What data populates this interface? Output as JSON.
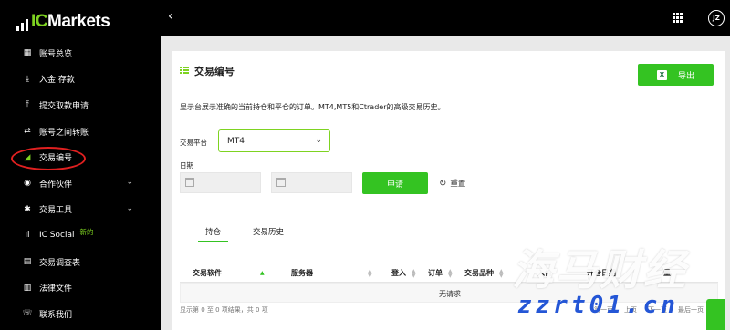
{
  "logo": {
    "prefix": "IC",
    "rest": "Markets"
  },
  "sidebar": {
    "items": [
      {
        "icon": "dashboard-icon",
        "label": "账号总览",
        "glyph": "▦"
      },
      {
        "icon": "deposit-icon",
        "label": "入金 存款",
        "glyph": "⤓"
      },
      {
        "icon": "withdraw-icon",
        "label": "提交取款申请",
        "glyph": "⤒"
      },
      {
        "icon": "transfer-icon",
        "label": "账号之间转账",
        "glyph": "⇄"
      },
      {
        "icon": "trade-history-icon",
        "label": "交易编号",
        "glyph": "◢"
      },
      {
        "icon": "partner-icon",
        "label": "合作伙伴",
        "glyph": "◉"
      },
      {
        "icon": "tools-icon",
        "label": "交易工具",
        "glyph": "✱"
      },
      {
        "icon": "ic-social-icon",
        "label": "IC Social",
        "glyph": "ıl",
        "badge": "新的"
      },
      {
        "icon": "survey-icon",
        "label": "交易调查表",
        "glyph": "▤"
      },
      {
        "icon": "legal-icon",
        "label": "法律文件",
        "glyph": "▥"
      },
      {
        "icon": "contact-icon",
        "label": "联系我们",
        "glyph": "☏"
      }
    ]
  },
  "topbar": {
    "back": "‹",
    "avatar": "JZ"
  },
  "card": {
    "title": "交易编号",
    "export_label": "导出",
    "description": "显示台展示准确的当前持仓和平仓的订单。MT4,MT5和Ctrader的高级交易历史。",
    "platform_label": "交易平台",
    "platform_value": "MT4",
    "date_label": "日期",
    "apply_label": "申请",
    "reset_label": "重置",
    "tabs": [
      "持仓",
      "交易历史"
    ],
    "table": {
      "columns": [
        "交易软件",
        "服务器",
        "登入",
        "订单",
        "交易品种",
        "入价",
        "开仓日期",
        "量"
      ],
      "empty_text": "无请求",
      "info": "显示第 0 至 0 项结果，共 0 项",
      "pager": [
        "第一页",
        "上页",
        "下一页",
        "最后一页"
      ]
    }
  },
  "watermark": {
    "brand": "海马财经",
    "url": "zzrt01.cn"
  },
  "colors": {
    "accent": "#34c322",
    "brand_green": "#7ed321",
    "highlight_circle": "#e02020"
  }
}
